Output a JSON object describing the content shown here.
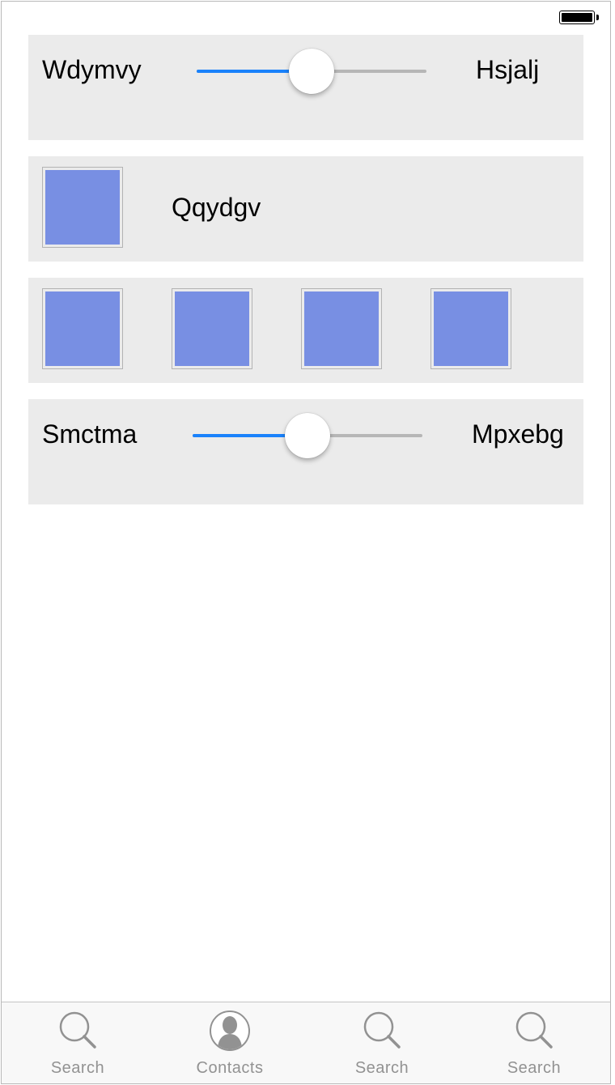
{
  "rows": [
    {
      "type": "slider",
      "left_label": "Wdymvy",
      "right_label": "Hsjalj",
      "value": 0.5
    },
    {
      "type": "image-label",
      "label": "Qqydgv"
    },
    {
      "type": "image-grid",
      "count": 4
    },
    {
      "type": "slider",
      "left_label": "Smctma",
      "right_label": "Mpxebg",
      "value": 0.5
    }
  ],
  "tab_bar": {
    "tabs": [
      {
        "label": "Search",
        "icon": "search-icon"
      },
      {
        "label": "Contacts",
        "icon": "contacts-icon"
      },
      {
        "label": "Search",
        "icon": "search-icon"
      },
      {
        "label": "Search",
        "icon": "search-icon"
      }
    ]
  },
  "colors": {
    "slider_fill": "#1a82fb",
    "tile": "#788fe3",
    "row_background": "#ebebeb",
    "tab_label": "#929292"
  }
}
